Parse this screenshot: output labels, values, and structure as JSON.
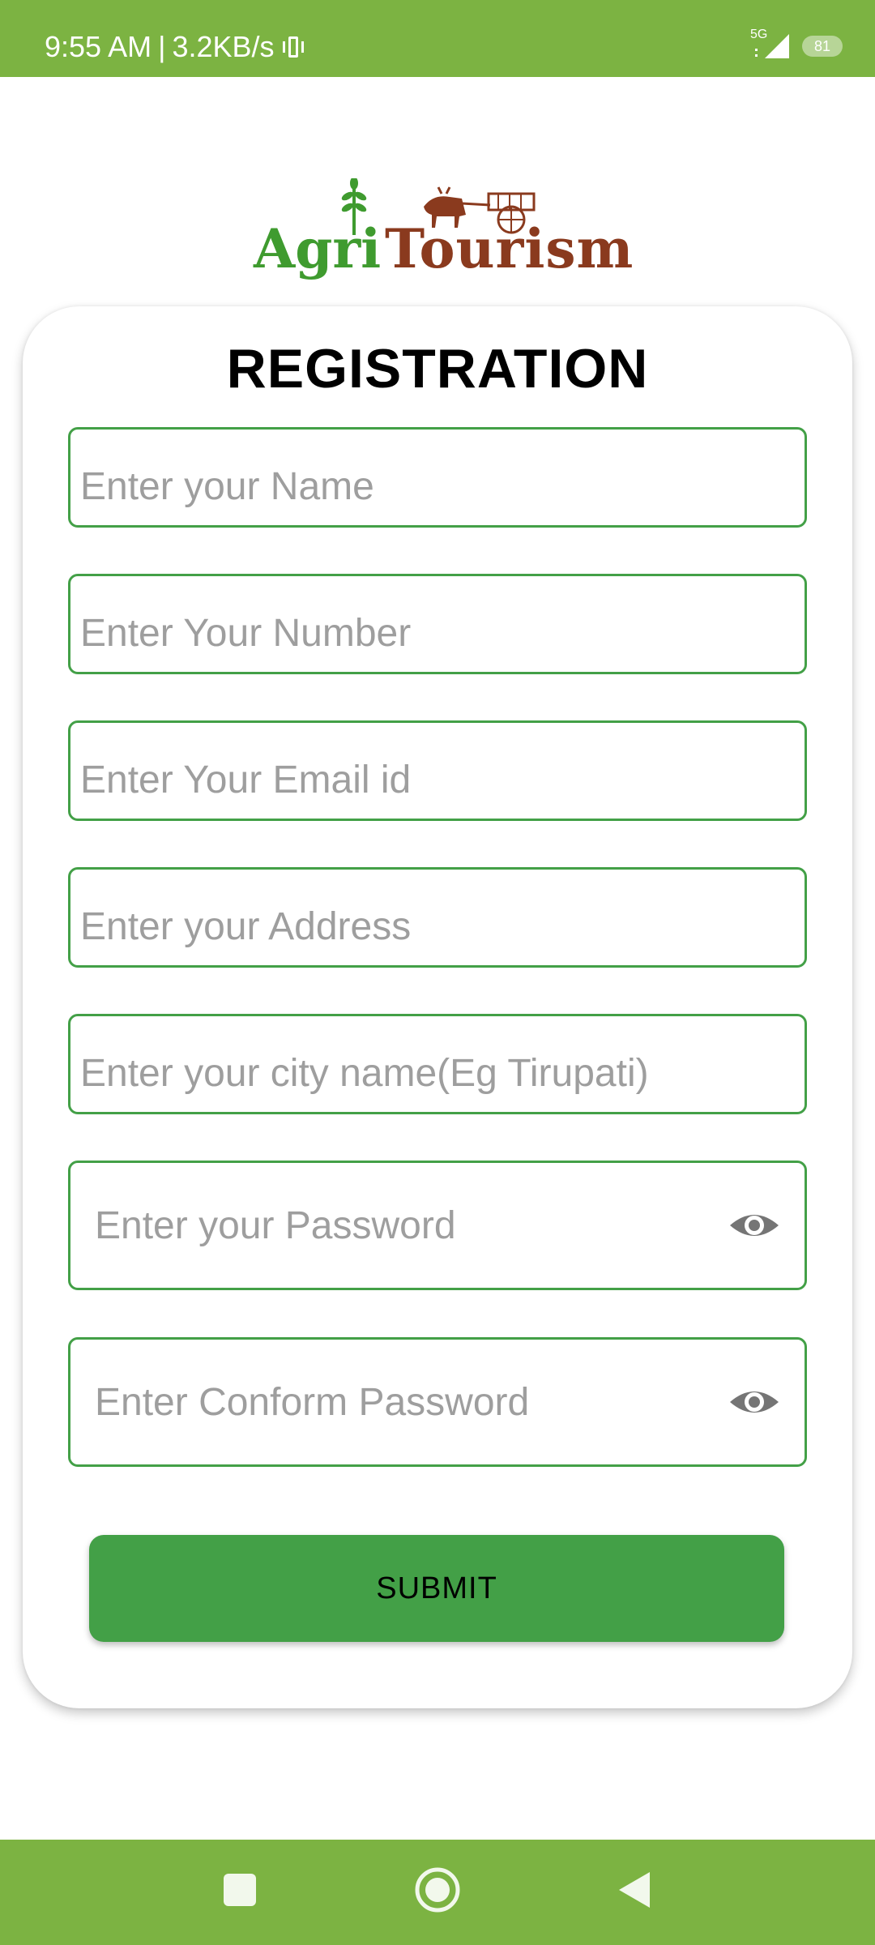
{
  "status_bar": {
    "time": "9:55 AM",
    "separator": "|",
    "speed": "3.2KB/s",
    "network": "5G",
    "battery": "81",
    "icons": [
      "vibrate-icon",
      "signal-icon",
      "battery-icon"
    ]
  },
  "logo": {
    "word1": "Agri",
    "word2": "Tourism"
  },
  "card": {
    "title": "REGISTRATION"
  },
  "form": {
    "name_placeholder": "Enter your Name",
    "number_placeholder": "Enter Your Number",
    "email_placeholder": "Enter Your Email id",
    "address_placeholder": "Enter your Address",
    "city_placeholder": "Enter your city name(Eg Tirupati)",
    "password_placeholder": "Enter your Password",
    "confirm_password_placeholder": "Enter Conform Password",
    "submit_label": "SUBMIT"
  },
  "nav": {
    "items": [
      "recents-button",
      "home-button",
      "back-button"
    ]
  },
  "colors": {
    "bar_green": "#7cb342",
    "border_green": "#43a047",
    "button_green": "#43a047",
    "logo_green": "#3f9b2f",
    "logo_brown": "#8a3a1e",
    "eye_gray": "#757575"
  }
}
